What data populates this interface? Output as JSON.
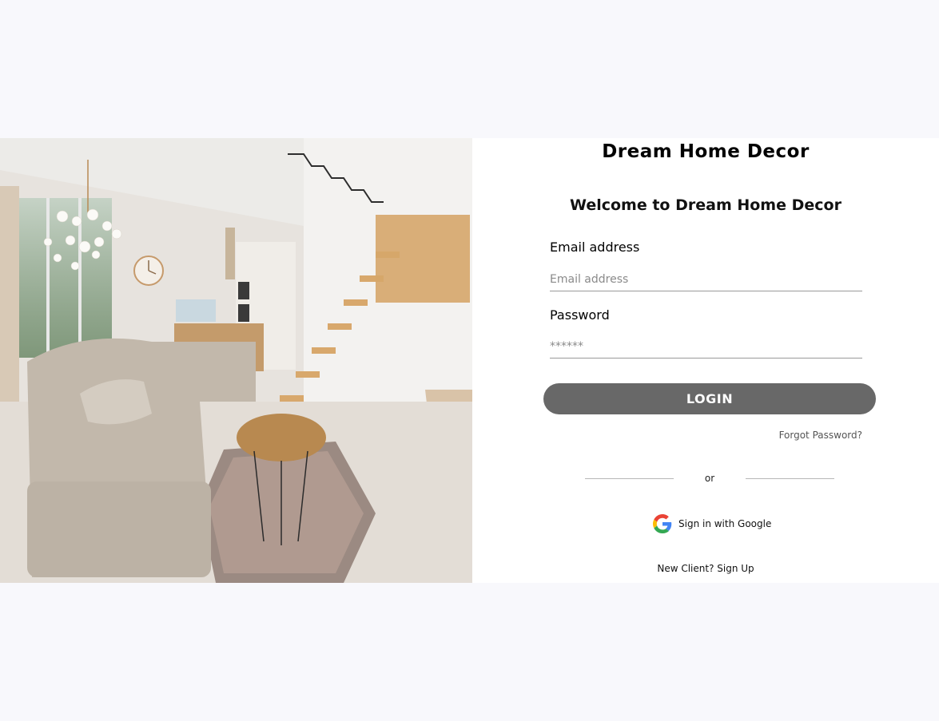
{
  "brand": {
    "title": "Dream Home Decor"
  },
  "form": {
    "welcome": "Welcome to Dream Home Decor",
    "email_label": "Email address",
    "email_placeholder": "Email address",
    "email_value": "",
    "password_label": "Password",
    "password_placeholder": "******",
    "password_value": "",
    "login_label": "LOGIN",
    "forgot_label": "Forgot Password?",
    "divider_text": "or",
    "google_label": "Sign in with Google",
    "signup_label": "New Client? Sign Up"
  },
  "colors": {
    "page_background": "#f8f8fc",
    "panel_background": "#ffffff",
    "login_button": "#686868",
    "google_blue": "#4285F4",
    "google_red": "#EA4335",
    "google_yellow": "#FBBC05",
    "google_green": "#34A853"
  },
  "icons": {
    "google": "google-g-logo"
  }
}
